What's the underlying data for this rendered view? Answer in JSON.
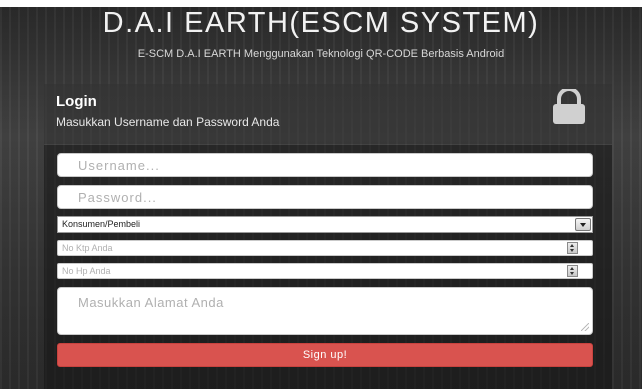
{
  "header": {
    "title": "D.A.I EARTH(ESCM SYSTEM)",
    "subtitle": "E-SCM D.A.I EARTH Menggunakan Teknologi QR-CODE Berbasis Android"
  },
  "login_panel": {
    "heading": "Login",
    "subheading": "Masukkan Username dan Password Anda",
    "icon": "lock-icon"
  },
  "form": {
    "username_placeholder": "Username...",
    "password_placeholder": "Password...",
    "role_selected": "Konsumen/Pembeli",
    "ktp_placeholder": "No Ktp Anda",
    "hp_placeholder": "No Hp Anda",
    "address_placeholder": "Masukkan Alamat Anda",
    "signup_label": "Sign up!"
  },
  "colors": {
    "accent": "#d9534f",
    "background": "#3a3a3a"
  }
}
